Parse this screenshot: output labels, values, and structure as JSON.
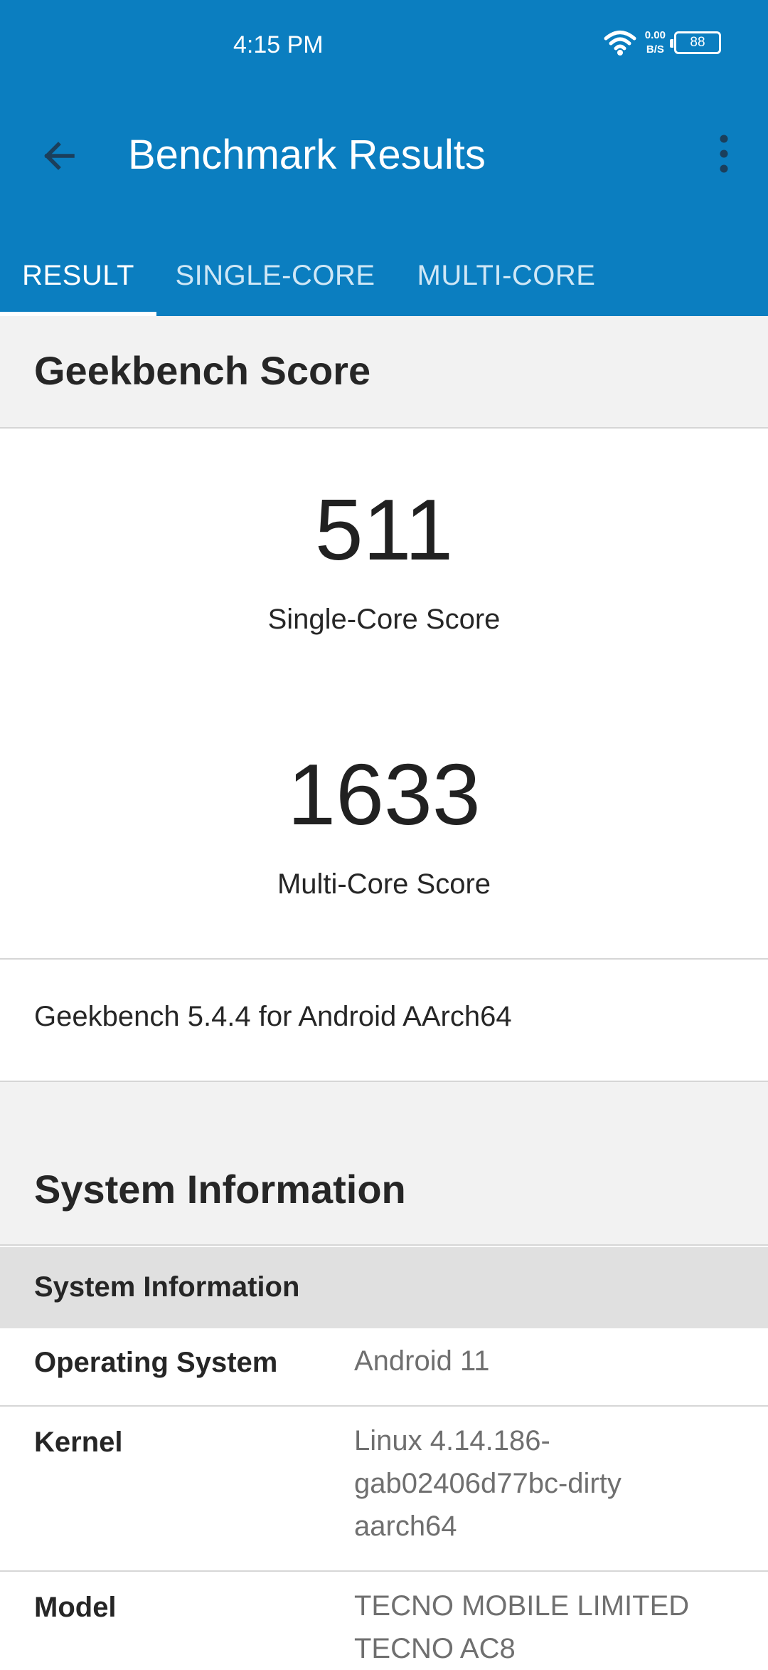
{
  "status_bar": {
    "time": "4:15 PM",
    "net_speed_value": "0.00",
    "net_speed_unit": "B/S",
    "battery": "88",
    "icons": [
      "wifi-icon",
      "battery-icon"
    ]
  },
  "app_bar": {
    "title": "Benchmark Results",
    "back_icon": "arrow-left-icon",
    "menu_icon": "more-vert-icon",
    "color": "#0b7ec0"
  },
  "tabs": [
    {
      "label": "RESULT",
      "active": true
    },
    {
      "label": "SINGLE-CORE",
      "active": false
    },
    {
      "label": "MULTI-CORE",
      "active": false
    }
  ],
  "geekbench_score": {
    "heading": "Geekbench Score",
    "single_core": {
      "value": "511",
      "label": "Single-Core Score"
    },
    "multi_core": {
      "value": "1633",
      "label": "Multi-Core Score"
    },
    "version": "Geekbench 5.4.4 for Android AArch64"
  },
  "system_information": {
    "heading": "System Information",
    "subheading": "System Information",
    "rows": [
      {
        "key": "Operating System",
        "value": "Android 11"
      },
      {
        "key": "Kernel",
        "value_lines": [
          "Linux 4.14.186-",
          "gab02406d77bc-dirty",
          "aarch64"
        ]
      },
      {
        "key": "Model",
        "value_lines": [
          "TECNO MOBILE LIMITED",
          "TECNO AC8"
        ]
      }
    ]
  }
}
